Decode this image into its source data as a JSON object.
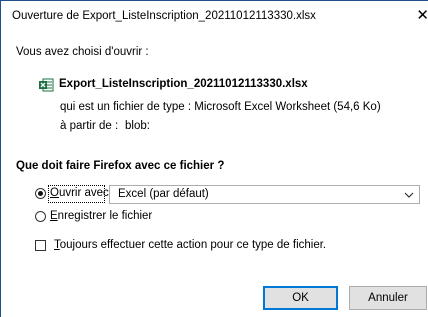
{
  "window": {
    "title": "Ouverture de Export_ListeInscription_20211012113330.xlsx",
    "close_glyph": "✕"
  },
  "intro": {
    "label": "Vous avez choisi d'ouvrir :",
    "file_name": "Export_ListeInscription_20211012113330.xlsx",
    "file_icon": "excel-file-icon",
    "type_line": "qui est un fichier de type : Microsoft Excel Worksheet (54,6 Ko)",
    "source_prefix": "à partir de :",
    "source_value": "blob:"
  },
  "question": "Que doit faire Firefox avec ce fichier ?",
  "options": {
    "open": {
      "accesskey": "O",
      "rest": "uvrir avec",
      "checked": true
    },
    "app_select": {
      "value": "Excel (par défaut)"
    },
    "save": {
      "accesskey": "E",
      "rest": "nregistrer le fichier",
      "checked": false
    },
    "always": {
      "accesskey": "T",
      "rest": "oujours effectuer cette action pour ce type de fichier.",
      "checked": false
    }
  },
  "buttons": {
    "ok": "OK",
    "cancel": "Annuler"
  },
  "colors": {
    "accent": "#0078d7",
    "window_border": "#1f4f8a",
    "excel_green": "#1d6f42"
  }
}
